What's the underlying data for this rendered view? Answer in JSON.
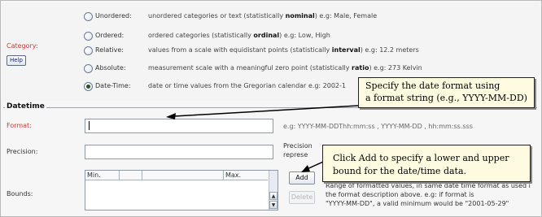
{
  "category": {
    "label": "Category:",
    "help_label": "Help",
    "options": [
      {
        "label": "Unordered:",
        "desc_pre": "unordered categories or text (statistically ",
        "desc_bold": "nominal",
        "desc_post": ") e.g: Male, Female",
        "selected": false
      },
      {
        "label": "Ordered:",
        "desc_pre": "ordered categories (statistically ",
        "desc_bold": "ordinal",
        "desc_post": ") e.g: Low, High",
        "selected": false
      },
      {
        "label": "Relative:",
        "desc_pre": "values from a scale with equidistant points (statistically ",
        "desc_bold": "interval",
        "desc_post": ") e.g: 12.2 meters",
        "selected": false
      },
      {
        "label": "Absolute:",
        "desc_pre": "measurement scale with a meaningful zero point (statistically ",
        "desc_bold": "ratio",
        "desc_post": ") e.g: 273 Kelvin",
        "selected": false
      },
      {
        "label": "Date-Time:",
        "desc_pre": "date or time values from the Gregorian calendar e.g: 2002-1",
        "desc_bold": "",
        "desc_post": "",
        "selected": true
      }
    ]
  },
  "datetime": {
    "group_title": "Datetime",
    "format_label": "Format:",
    "format_value": "",
    "format_hint": "e.g: YYYY-MM-DDThh:mm:ss ,  YYYY-MM-DD ,  hh:mm:ss.sss",
    "precision_label": "Precision:",
    "precision_value": "",
    "precision_hint_1": "Precision",
    "precision_hint_2": "represe",
    "bounds_label": "Bounds:",
    "bounds_columns": [
      "Min.",
      "",
      "",
      "Max."
    ],
    "add_label": "Add",
    "delete_label": "Delete",
    "bounds_hint_1": "Range of formatted values, in same date time format as used i",
    "bounds_hint_2": "the format description above.  e.g: if format is",
    "bounds_hint_3": "\"YYYY-MM-DD\", a valid minimum would be \"2001-05-29\""
  },
  "callouts": {
    "format_callout_line1": "Specify the date format using",
    "format_callout_line2": "a format string (e.g., YYYY-MM-DD)",
    "add_callout_line1": "Click Add to specify a lower and upper",
    "add_callout_line2": "bound for the date/time data."
  }
}
